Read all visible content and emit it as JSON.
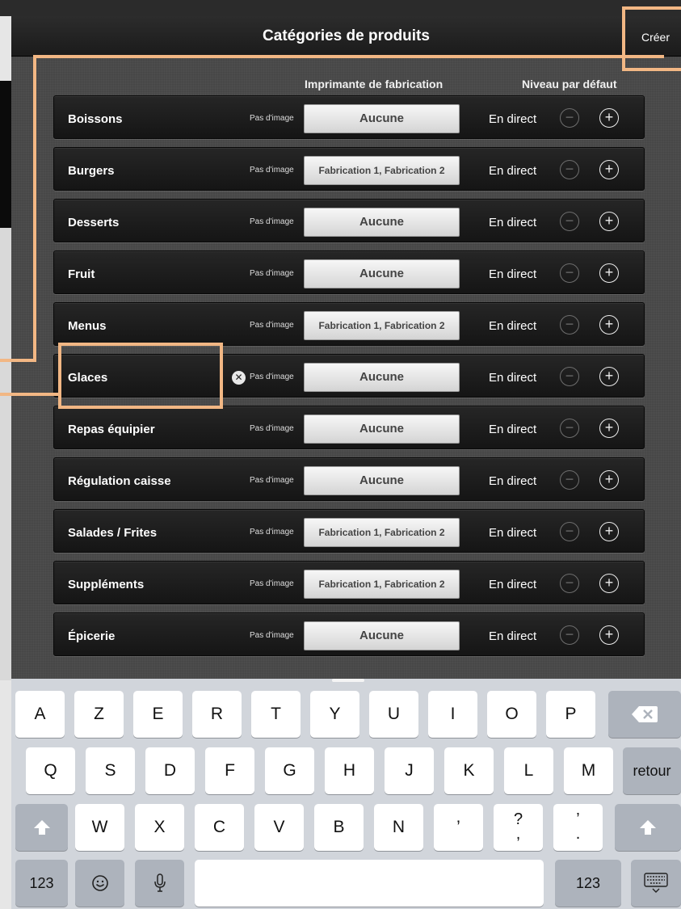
{
  "navbar": {
    "title": "Catégories de produits",
    "create_label": "Créer"
  },
  "columns": {
    "printer": "Imprimante de fabrication",
    "level": "Niveau par défaut"
  },
  "categories": [
    {
      "name": "Boissons",
      "image": "Pas d'image",
      "printer": "Aucune",
      "level": "En direct"
    },
    {
      "name": "Burgers",
      "image": "Pas d'image",
      "printer": "Fabrication 1, Fabrication 2",
      "level": "En direct"
    },
    {
      "name": "Desserts",
      "image": "Pas d'image",
      "printer": "Aucune",
      "level": "En direct"
    },
    {
      "name": "Fruit",
      "image": "Pas d'image",
      "printer": "Aucune",
      "level": "En direct"
    },
    {
      "name": "Menus",
      "image": "Pas d'image",
      "printer": "Fabrication 1, Fabrication 2",
      "level": "En direct"
    },
    {
      "name": "Glaces",
      "image": "Pas d'image",
      "printer": "Aucune",
      "level": "En direct"
    },
    {
      "name": "Repas équipier",
      "image": "Pas d'image",
      "printer": "Aucune",
      "level": "En direct"
    },
    {
      "name": "Régulation caisse",
      "image": "Pas d'image",
      "printer": "Aucune",
      "level": "En direct"
    },
    {
      "name": "Salades / Frites",
      "image": "Pas d'image",
      "printer": "Fabrication 1, Fabrication 2",
      "level": "En direct"
    },
    {
      "name": "Suppléments",
      "image": "Pas d'image",
      "printer": "Fabrication 1, Fabrication 2",
      "level": "En direct"
    },
    {
      "name": "Épicerie",
      "image": "Pas d'image",
      "printer": "Aucune",
      "level": "En direct"
    }
  ],
  "keyboard": {
    "row1": [
      "A",
      "Z",
      "E",
      "R",
      "T",
      "Y",
      "U",
      "I",
      "O",
      "P"
    ],
    "row2": [
      "Q",
      "S",
      "D",
      "F",
      "G",
      "H",
      "J",
      "K",
      "L",
      "M"
    ],
    "row3": [
      "W",
      "X",
      "C",
      "V",
      "B",
      "N"
    ],
    "apostrophe": "’",
    "question": {
      "top": "?",
      "bottom": ","
    },
    "quote": {
      "top": "’",
      "bottom": "."
    },
    "return_label": "retour",
    "numbers_left": "123",
    "numbers_right": "123"
  },
  "icons": {
    "delete": "x-circle-icon",
    "minus": "minus-circle-icon",
    "plus": "plus-circle-icon",
    "backspace": "backspace-icon",
    "shift": "shift-arrow-icon",
    "emoji": "emoji-icon",
    "mic": "microphone-icon",
    "hide_keyboard": "keyboard-dismiss-icon"
  },
  "colors": {
    "callout": "#f2b784",
    "navbar": "#1f1f1f",
    "row_bg": "#1c1c1c"
  }
}
